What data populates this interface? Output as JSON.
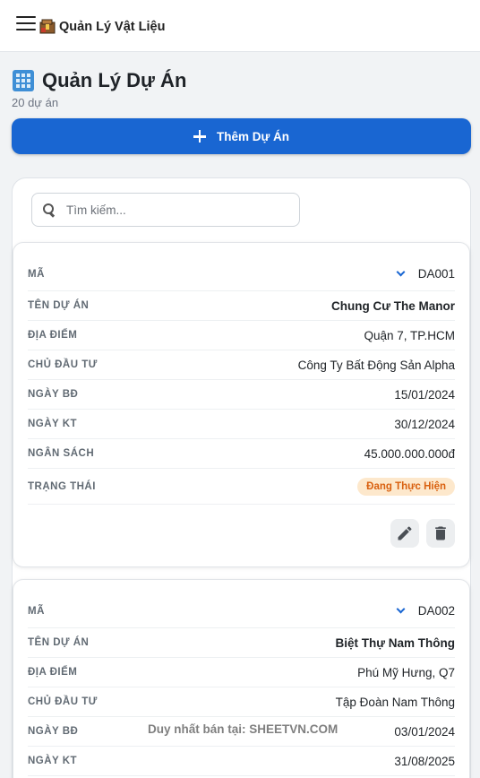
{
  "app": {
    "title": "Quản Lý Vật Liệu"
  },
  "page": {
    "title": "Quản Lý Dự Án",
    "count_text": "20 dự án",
    "add_button": "Thêm Dự Án"
  },
  "search": {
    "placeholder": "Tìm kiếm..."
  },
  "labels": {
    "code": "MÃ",
    "name": "TÊN DỰ ÁN",
    "location": "ĐỊA ĐIỂM",
    "investor": "CHỦ ĐẦU TƯ",
    "start": "NGÀY BĐ",
    "end": "NGÀY KT",
    "budget": "NGÂN SÁCH",
    "status": "TRẠNG THÁI"
  },
  "projects": [
    {
      "code": "DA001",
      "name": "Chung Cư The Manor",
      "location": "Quận 7, TP.HCM",
      "investor": "Công Ty Bất Động Sản Alpha",
      "start": "15/01/2024",
      "end": "30/12/2024",
      "budget": "45.000.000.000đ",
      "status": "Đang Thực Hiện"
    },
    {
      "code": "DA002",
      "name": "Biệt Thự Nam Thông",
      "location": "Phú Mỹ Hưng, Q7",
      "investor": "Tập Đoàn Nam Thông",
      "start": "03/01/2024",
      "end": "31/08/2025"
    }
  ],
  "watermark": "Duy nhất bán tại: SHEETVN.COM",
  "colors": {
    "primary": "#1966d2",
    "status_bg": "#fde8cc",
    "status_text": "#d9600f"
  },
  "icons": [
    "menu-icon",
    "box-logo-icon",
    "building-icon",
    "plus-icon",
    "search-icon",
    "chevron-down-icon",
    "edit-icon",
    "delete-icon"
  ]
}
